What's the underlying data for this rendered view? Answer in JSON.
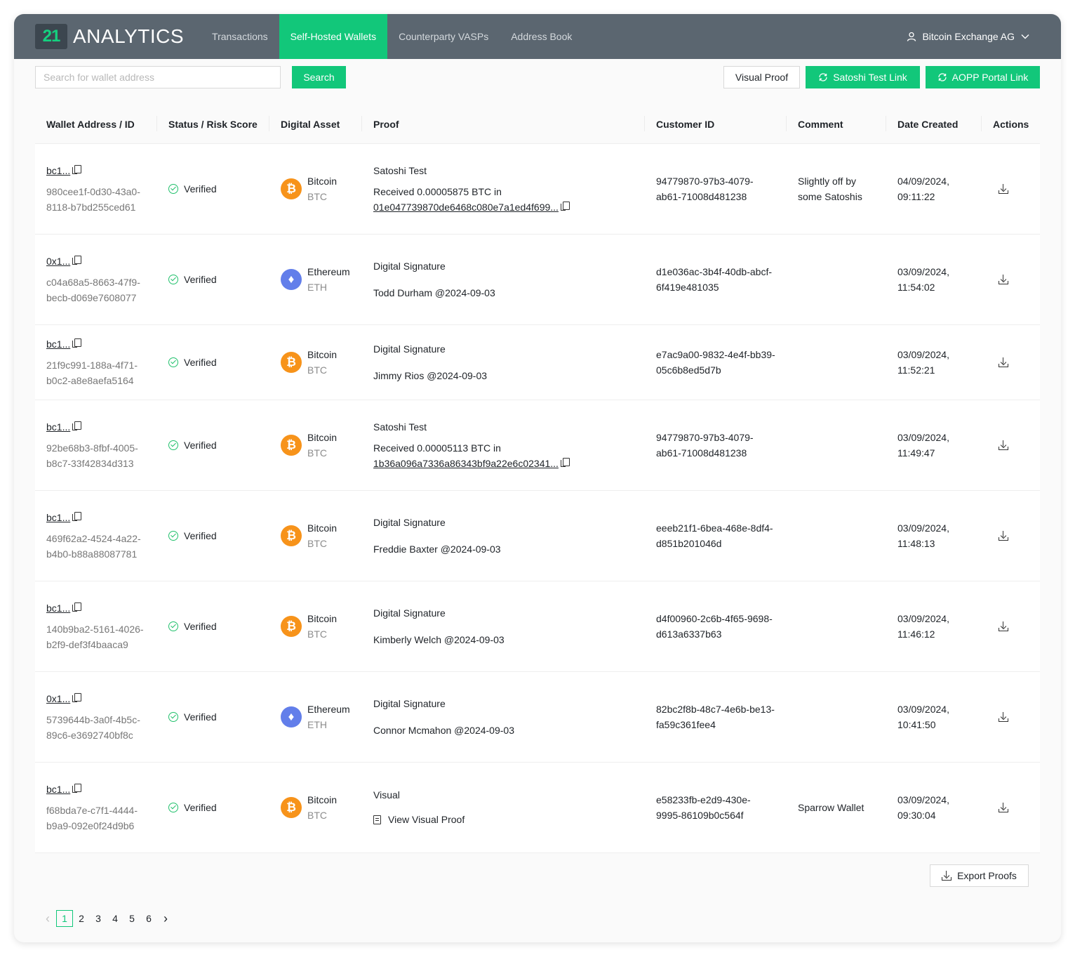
{
  "brand": {
    "logo_mark": "21",
    "logo_text": "ANALYTICS",
    "accent": "#12c77a",
    "header_bg": "#5b6670"
  },
  "nav": [
    {
      "label": "Transactions",
      "active": false
    },
    {
      "label": "Self-Hosted Wallets",
      "active": true
    },
    {
      "label": "Counterparty VASPs",
      "active": false
    },
    {
      "label": "Address Book",
      "active": false
    }
  ],
  "user": {
    "name": "Bitcoin Exchange AG",
    "icon": "user-icon",
    "menu_icon": "chevron-down-icon"
  },
  "toolbar": {
    "search_placeholder": "Search for wallet address",
    "search_value": "",
    "search_label": "Search",
    "visual_proof_label": "Visual Proof",
    "satoshi_link_label": "Satoshi Test Link",
    "aopp_link_label": "AOPP Portal Link"
  },
  "table": {
    "headers": [
      "Wallet Address / ID",
      "Status / Risk Score",
      "Digital Asset",
      "Proof",
      "Customer ID",
      "Comment",
      "Date Created",
      "Actions"
    ],
    "rows": [
      {
        "address": "bc1...",
        "wallet_id": "980cee1f-0d30-43a0-8118-b7bd255ced61",
        "status": "Verified",
        "asset_name": "Bitcoin",
        "asset_ticker": "BTC",
        "asset_type": "btc",
        "proof_type": "satoshi",
        "proof_title": "Satoshi Test",
        "proof_line1": "Received 0.00005875 BTC in",
        "proof_tx": "01e047739870de6468c080e7a1ed4f699...",
        "customer_id": "94779870-97b3-4079-ab61-71008d481238",
        "comment": "Slightly off by some Satoshis",
        "date": "04/09/2024,",
        "time": "09:11:22"
      },
      {
        "address": "0x1...",
        "wallet_id": "c04a68a5-8663-47f9-becb-d069e7608077",
        "status": "Verified",
        "asset_name": "Ethereum",
        "asset_ticker": "ETH",
        "asset_type": "eth",
        "proof_type": "signature",
        "proof_title": "Digital Signature",
        "proof_line1": "Todd Durham @2024-09-03",
        "proof_tx": "",
        "customer_id": "d1e036ac-3b4f-40db-abcf-6f419e481035",
        "comment": "",
        "date": "03/09/2024,",
        "time": "11:54:02"
      },
      {
        "address": "bc1...",
        "wallet_id": "21f9c991-188a-4f71-b0c2-a8e8aefa5164",
        "status": "Verified",
        "asset_name": "Bitcoin",
        "asset_ticker": "BTC",
        "asset_type": "btc",
        "proof_type": "signature",
        "proof_title": "Digital Signature",
        "proof_line1": "Jimmy Rios @2024-09-03",
        "proof_tx": "",
        "customer_id": "e7ac9a00-9832-4e4f-bb39-05c6b8ed5d7b",
        "comment": "",
        "date": "03/09/2024,",
        "time": "11:52:21"
      },
      {
        "address": "bc1...",
        "wallet_id": "92be68b3-8fbf-4005-b8c7-33f42834d313",
        "status": "Verified",
        "asset_name": "Bitcoin",
        "asset_ticker": "BTC",
        "asset_type": "btc",
        "proof_type": "satoshi",
        "proof_title": "Satoshi Test",
        "proof_line1": "Received 0.00005113 BTC in",
        "proof_tx": "1b36a096a7336a86343bf9a22e6c02341...",
        "customer_id": "94779870-97b3-4079-ab61-71008d481238",
        "comment": "",
        "date": "03/09/2024,",
        "time": "11:49:47"
      },
      {
        "address": "bc1...",
        "wallet_id": "469f62a2-4524-4a22-b4b0-b88a88087781",
        "status": "Verified",
        "asset_name": "Bitcoin",
        "asset_ticker": "BTC",
        "asset_type": "btc",
        "proof_type": "signature",
        "proof_title": "Digital Signature",
        "proof_line1": "Freddie Baxter @2024-09-03",
        "proof_tx": "",
        "customer_id": "eeeb21f1-6bea-468e-8df4-d851b201046d",
        "comment": "",
        "date": "03/09/2024,",
        "time": "11:48:13"
      },
      {
        "address": "bc1...",
        "wallet_id": "140b9ba2-5161-4026-b2f9-def3f4baaca9",
        "status": "Verified",
        "asset_name": "Bitcoin",
        "asset_ticker": "BTC",
        "asset_type": "btc",
        "proof_type": "signature",
        "proof_title": "Digital Signature",
        "proof_line1": "Kimberly Welch @2024-09-03",
        "proof_tx": "",
        "customer_id": "d4f00960-2c6b-4f65-9698-d613a6337b63",
        "comment": "",
        "date": "03/09/2024,",
        "time": "11:46:12"
      },
      {
        "address": "0x1...",
        "wallet_id": "5739644b-3a0f-4b5c-89c6-e3692740bf8c",
        "status": "Verified",
        "asset_name": "Ethereum",
        "asset_ticker": "ETH",
        "asset_type": "eth",
        "proof_type": "signature",
        "proof_title": "Digital Signature",
        "proof_line1": "Connor Mcmahon @2024-09-03",
        "proof_tx": "",
        "customer_id": "82bc2f8b-48c7-4e6b-be13-fa59c361fee4",
        "comment": "",
        "date": "03/09/2024,",
        "time": "10:41:50"
      },
      {
        "address": "bc1...",
        "wallet_id": "f68bda7e-c7f1-4444-b9a9-092e0f24d9b6",
        "status": "Verified",
        "asset_name": "Bitcoin",
        "asset_ticker": "BTC",
        "asset_type": "btc",
        "proof_type": "visual",
        "proof_title": "Visual",
        "proof_line1": "View Visual Proof",
        "proof_tx": "",
        "customer_id": "e58233fb-e2d9-430e-9995-86109b0c564f",
        "comment": "Sparrow Wallet",
        "date": "03/09/2024,",
        "time": "09:30:04"
      }
    ]
  },
  "export_label": "Export Proofs",
  "pagination": {
    "pages": [
      "1",
      "2",
      "3",
      "4",
      "5",
      "6"
    ],
    "current": "1",
    "prev_icon": "chevron-left-icon",
    "next_icon": "chevron-right-icon"
  }
}
